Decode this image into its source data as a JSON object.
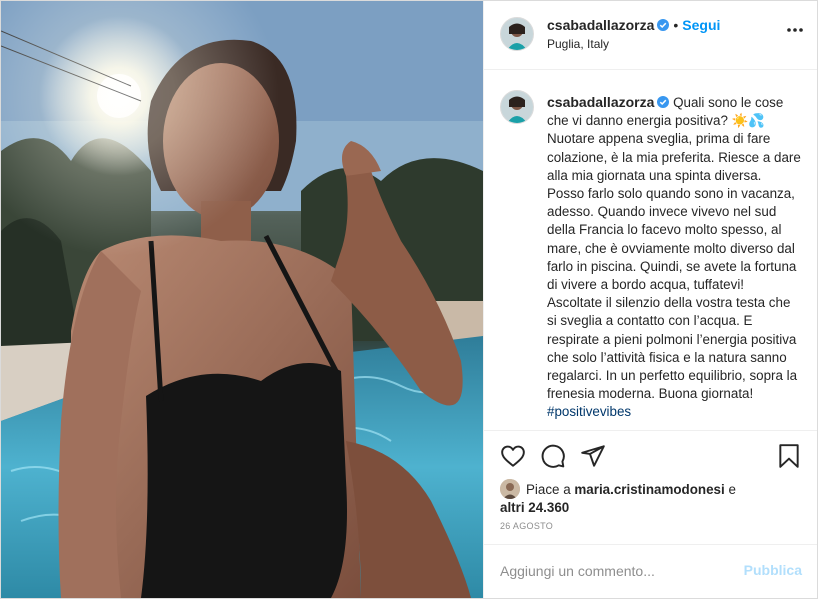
{
  "post": {
    "username": "csabadallazorza",
    "follow_label": "Segui",
    "dot": "•",
    "location": "Puglia, Italy",
    "caption": "Quali sono le cose che vi danno energia positiva? ☀️💦 Nuotare appena sveglia, prima di fare colazione, è la mia preferita. Riesce a dare alla mia giornata una spinta diversa. Posso farlo solo quando sono in vacanza, adesso. Quando invece vivevo nel sud della Francia lo facevo molto spesso, al mare, che è ovviamente molto diverso dal farlo in piscina. Quindi, se avete la fortuna di vivere a bordo acqua, tuffatevi! Ascoltate il silenzio della vostra testa che si sveglia a contatto con l’acqua. E respirate a pieni polmoni l’energia positiva che solo l’attività fisica e la natura sanno regalarci. In un perfetto equilibrio, sopra la frenesia moderna. Buona giornata! ",
    "hashtag": "#positivevibes",
    "likes_prefix": "Piace a ",
    "likes_user": "maria.cristinamodonesi",
    "likes_joiner": " e",
    "likes_others": "altri 24.360",
    "date": "26 AGOSTO",
    "comment_placeholder": "Aggiungi un commento...",
    "publish_label": "Pubblica"
  },
  "icons": {
    "more": "more-options-icon",
    "like": "heart-icon",
    "comment": "comment-icon",
    "share": "share-icon",
    "save": "bookmark-icon",
    "verified": "verified-badge-icon"
  },
  "colors": {
    "accent": "#0095f6",
    "publish_disabled": "#b2dffc",
    "verified": "#3897f0",
    "muted": "#8e8e8e"
  }
}
